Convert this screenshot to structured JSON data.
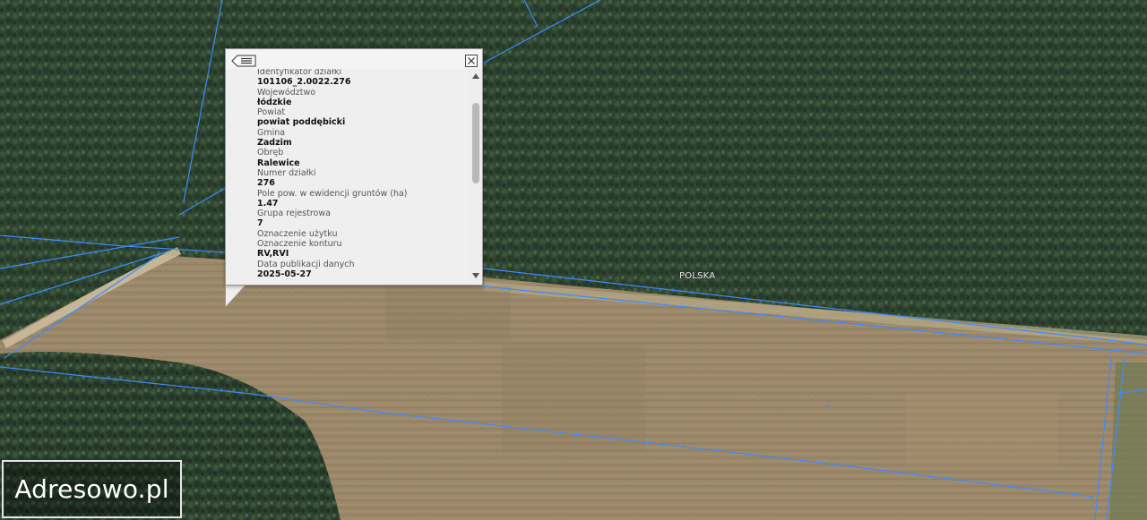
{
  "map": {
    "country_label": "POLSKA",
    "colors": {
      "forest": "#2c3f2d",
      "field": "#9a8668",
      "parcel_line": "#3b8cff"
    }
  },
  "popup": {
    "back_icon": "list-back-icon",
    "close_icon": "close-x-icon",
    "fields": [
      {
        "label": "Identyfikator działki",
        "value": "101106_2.0022.276"
      },
      {
        "label": "Województwo",
        "value": "łódzkie"
      },
      {
        "label": "Powiat",
        "value": "powiat poddębicki"
      },
      {
        "label": "Gmina",
        "value": "Zadzim"
      },
      {
        "label": "Obręb",
        "value": "Ralewice"
      },
      {
        "label": "Numer działki",
        "value": "276"
      },
      {
        "label": "Pole pow. w ewidencji gruntów (ha)",
        "value": "1.47"
      },
      {
        "label": "Grupa rejestrowa",
        "value": "7"
      },
      {
        "label": "Oznaczenie użytku",
        "value": ""
      },
      {
        "label": "Oznaczenie konturu",
        "value": "RV,RVI"
      },
      {
        "label": "Data publikacji danych",
        "value": "2025-05-27"
      }
    ]
  },
  "logo": {
    "text": "Adresowo.pl"
  }
}
